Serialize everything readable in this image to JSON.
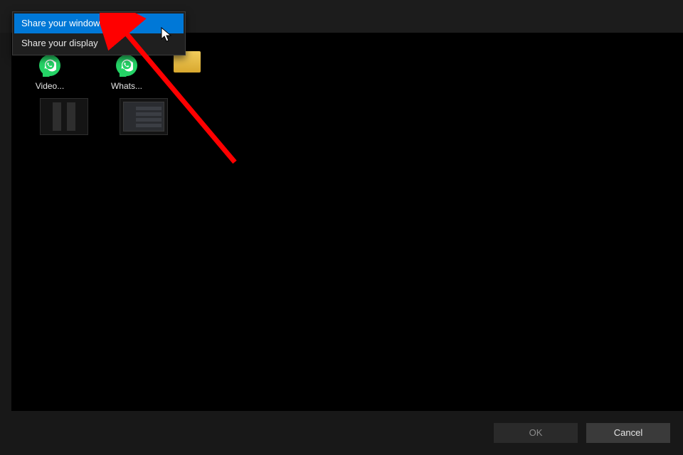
{
  "context_menu": {
    "items": [
      {
        "label": "Share your window",
        "selected": true
      },
      {
        "label": "Share your display",
        "selected": false
      }
    ]
  },
  "desktop": {
    "items": [
      {
        "label": "Video..."
      },
      {
        "label": "Whats..."
      }
    ]
  },
  "buttons": {
    "ok": "OK",
    "cancel": "Cancel"
  }
}
